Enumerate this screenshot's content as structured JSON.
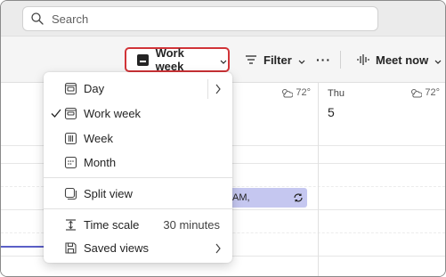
{
  "search": {
    "placeholder": "Search"
  },
  "toolbar": {
    "view_label": "Work week",
    "filter_label": "Filter",
    "more_label": "···",
    "meet_label": "Meet now"
  },
  "calendar": {
    "days": [
      {
        "name": "",
        "number": "",
        "weather": "72°"
      },
      {
        "name": "Thu",
        "number": "5",
        "weather": "72°"
      }
    ],
    "event": {
      "title": "AM,"
    }
  },
  "view_menu": {
    "items": [
      {
        "label": "Day",
        "icon": "day-view-icon",
        "has_submenu": true
      },
      {
        "label": "Work week",
        "icon": "work-week-view-icon",
        "checked": true
      },
      {
        "label": "Week",
        "icon": "week-view-icon"
      },
      {
        "label": "Month",
        "icon": "month-view-icon"
      },
      {
        "label": "Split view",
        "icon": "split-view-icon"
      },
      {
        "label": "Time scale",
        "icon": "time-scale-icon",
        "value": "30 minutes"
      },
      {
        "label": "Saved views",
        "icon": "saved-views-icon",
        "has_submenu": true
      }
    ]
  },
  "colors": {
    "accent": "#5b5fc7",
    "highlight_border": "#d13438",
    "event_fill": "#c5c7f0"
  }
}
